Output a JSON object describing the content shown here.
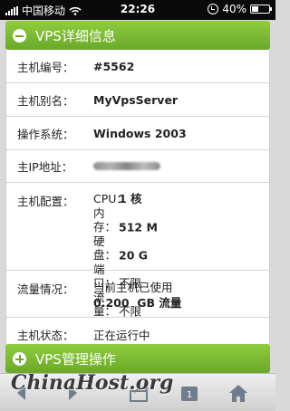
{
  "status_bar": {
    "carrier": "中国移动",
    "time": "22:26",
    "battery": "40%",
    "battery_level": 0.4
  },
  "header": {
    "title": "VPS详细信息",
    "icon": "minus-circle-icon"
  },
  "details": {
    "host_id": {
      "label": "主机编号：",
      "value": "#5562"
    },
    "host_alias": {
      "label": "主机别名：",
      "value": "MyVpsServer"
    },
    "os": {
      "label": "操作系统：",
      "value": "Windows 2003"
    },
    "ip": {
      "label": "主IP地址：",
      "value": ""
    },
    "config": {
      "label": "主机配置：",
      "cpu_key": "CPU：",
      "cpu_val": "1 核",
      "mem_key": "内存：",
      "mem_val": "512 M",
      "disk_key": "硬盘：",
      "disk_val": "20 G",
      "port_key": "端口：",
      "port_val": "不限",
      "traffic_key": "流量：",
      "traffic_val": "不限"
    },
    "traffic": {
      "label": "流量情况：",
      "line1": "当前主机已使用",
      "line2": "0.200  GB 流量"
    },
    "status": {
      "label": "主机状态：",
      "value": "正在运行中"
    }
  },
  "footer": {
    "title": "VPS管理操作",
    "icon": "plus-circle-icon"
  },
  "watermark": {
    "text": "ChinaHost.org"
  },
  "toolbar": {
    "icons": [
      "back-arrow-icon",
      "forward-arrow-icon",
      "share-icon",
      "tabs-icon",
      "home-icon"
    ],
    "tabs_count": "1"
  }
}
